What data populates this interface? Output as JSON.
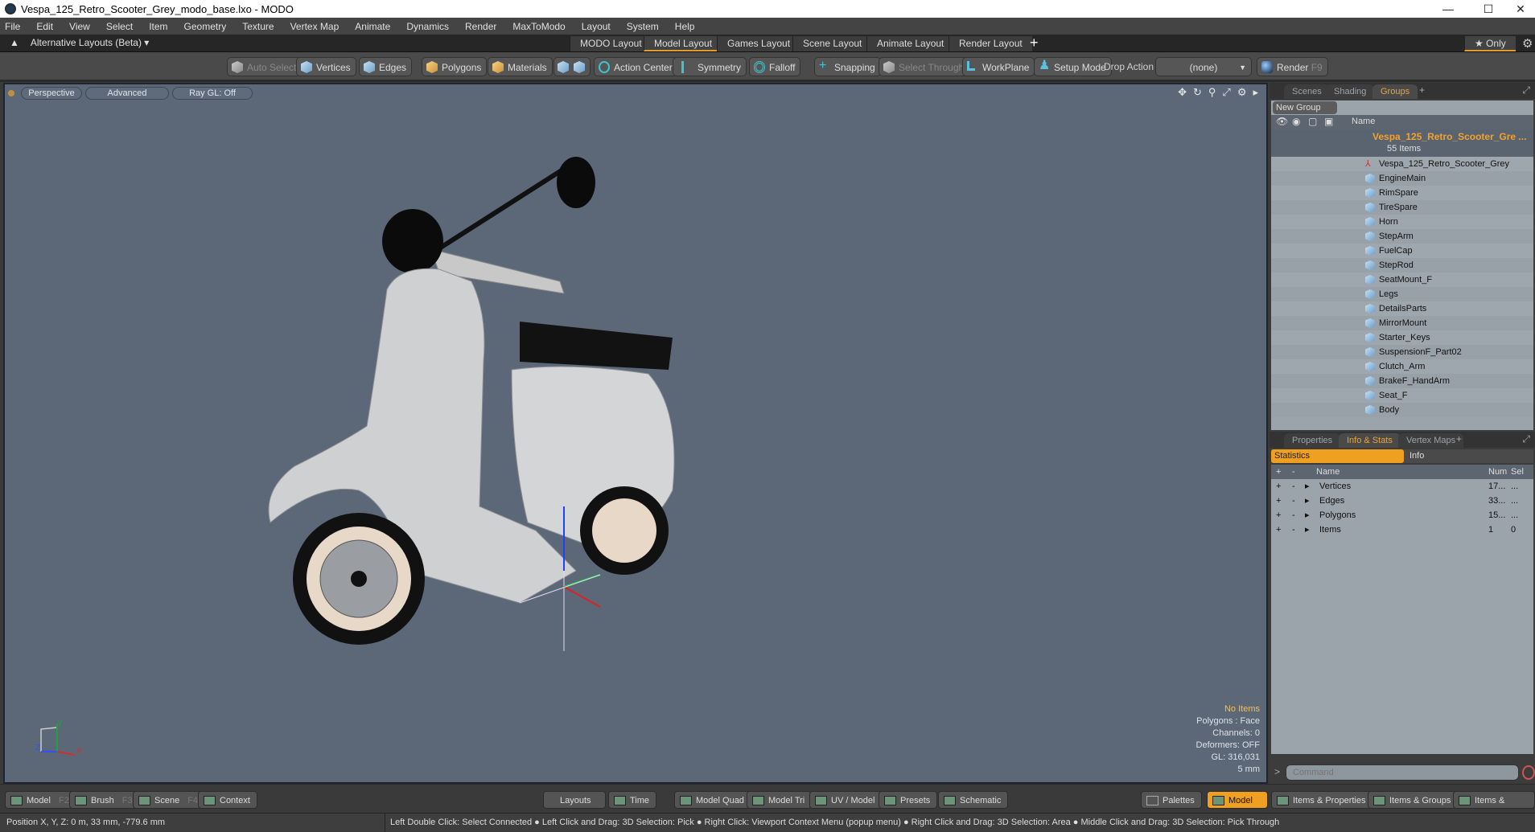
{
  "window": {
    "title": "Vespa_125_Retro_Scooter_Grey_modo_base.lxo - MODO",
    "controls": [
      "minimize",
      "maximize",
      "close"
    ]
  },
  "menu": [
    "File",
    "Edit",
    "View",
    "Select",
    "Item",
    "Geometry",
    "Texture",
    "Vertex Map",
    "Animate",
    "Dynamics",
    "Render",
    "MaxToModo",
    "Layout",
    "System",
    "Help"
  ],
  "layoutbar": {
    "alt_layouts": "Alternative Layouts (Beta) ▾",
    "tabs": [
      "MODO Layout",
      "Model Layout",
      "Games Layout",
      "Scene Layout",
      "Animate Layout",
      "Render Layout"
    ],
    "active_tab": "Model Layout",
    "add": "+",
    "only": "★ Only"
  },
  "toolbar": {
    "auto_select": "Auto Select",
    "vertices": "Vertices",
    "edges": "Edges",
    "polygons": "Polygons",
    "materials": "Materials",
    "action_center": "Action Center",
    "symmetry": "Symmetry",
    "falloff": "Falloff",
    "snapping": "Snapping",
    "select_through": "Select Through",
    "workplane": "WorkPlane",
    "setup_mode": "Setup Mode",
    "drop_action_label": "Drop Action",
    "drop_action_value": "(none)",
    "render": "Render",
    "render_key": "F9"
  },
  "viewport": {
    "view": "Perspective",
    "shading": "Advanced",
    "raygl": "Ray GL: Off",
    "info": {
      "selection": "No Items",
      "polygons": "Polygons : Face",
      "channels": "Channels: 0",
      "deformers": "Deformers: OFF",
      "gl": "GL: 316,031",
      "grid": "5 mm"
    },
    "axis_labels": {
      "x": "X",
      "y": "Y",
      "z": "Z"
    }
  },
  "groups_panel": {
    "tabs": [
      "Scenes",
      "Shading",
      "Groups"
    ],
    "active_tab": "Groups",
    "new_group": "New Group",
    "name_header": "Name",
    "root": {
      "name": "Vespa_125_Retro_Scooter_Gre ...",
      "count": "55 Items"
    },
    "items": [
      "Vespa_125_Retro_Scooter_Grey",
      "EngineMain",
      "RimSpare",
      "TireSpare",
      "Horn",
      "StepArm",
      "FuelCap",
      "StepRod",
      "SeatMount_F",
      "Legs",
      "DetailsParts",
      "MirrorMount",
      "Starter_Keys",
      "SuspensionF_Part02",
      "Clutch_Arm",
      "BrakeF_HandArm",
      "Seat_F",
      "Body"
    ]
  },
  "info_panel": {
    "tabs": [
      "Properties",
      "Info & Stats",
      "Vertex Maps"
    ],
    "active_tab": "Info & Stats",
    "subtabs": [
      "Statistics",
      "Info"
    ],
    "columns": [
      "+",
      "-",
      "Name",
      "Num",
      "Sel"
    ],
    "rows": [
      {
        "name": "Vertices",
        "num": "17...",
        "sel": "..."
      },
      {
        "name": "Edges",
        "num": "33...",
        "sel": "..."
      },
      {
        "name": "Polygons",
        "num": "15...",
        "sel": "..."
      },
      {
        "name": "Items",
        "num": "1",
        "sel": "0"
      }
    ],
    "command_placeholder": "Command"
  },
  "bottom_tabs": {
    "left": [
      {
        "label": "Model",
        "key": "F2"
      },
      {
        "label": "Brush",
        "key": "F3"
      },
      {
        "label": "Scene",
        "key": "F4"
      },
      {
        "label": "Context",
        "key": ""
      }
    ],
    "center": [
      "Layouts",
      "Time",
      "Model Quad",
      "Model Tri",
      "UV / Model",
      "Presets",
      "Schematic"
    ],
    "right": [
      "Palettes",
      "Model",
      "Items & Properties",
      "Items & Groups",
      "Items & Shading"
    ]
  },
  "status": {
    "position": "Position X, Y, Z:   0 m, 33 mm, -779.6 mm",
    "hints": "Left Double Click: Select Connected ● Left Click and Drag: 3D Selection: Pick ● Right Click: Viewport Context Menu (popup menu) ● Right Click and Drag: 3D Selection: Area ● Middle Click and Drag: 3D Selection: Pick Through"
  },
  "colors": {
    "accent": "#f0a020",
    "viewport_bg": "#5c6878",
    "highlight_text": "#f2a22c"
  }
}
